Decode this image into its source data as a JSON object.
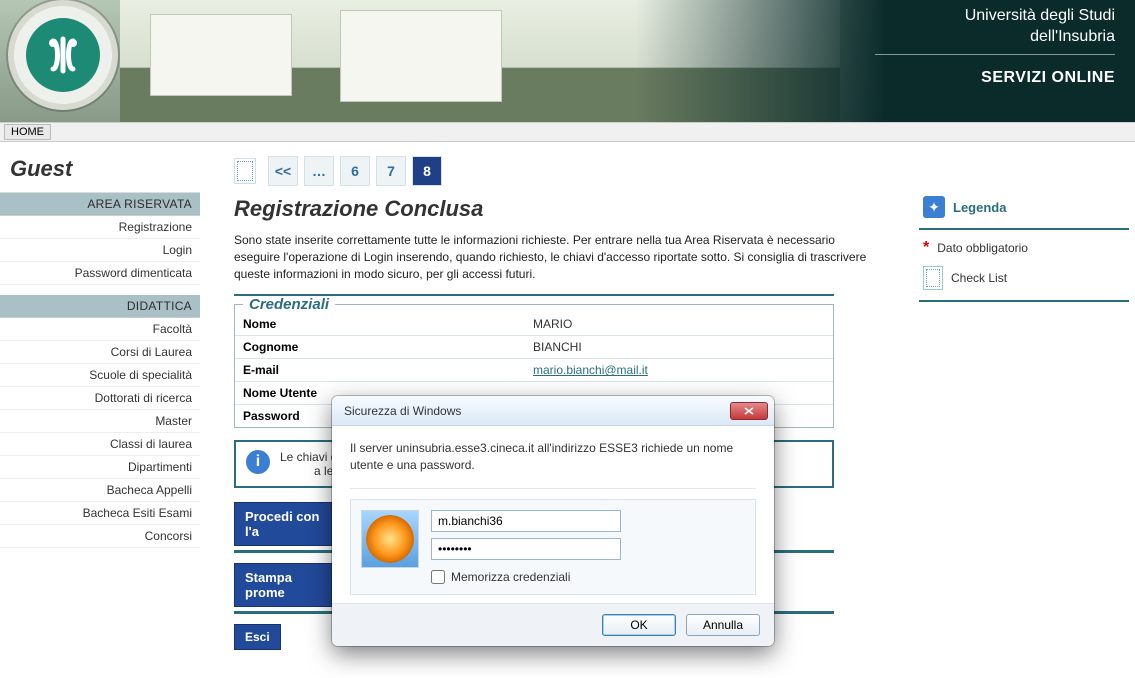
{
  "banner": {
    "university_line1": "Università degli Studi",
    "university_line2": "dell'Insubria",
    "services_label": "SERVIZI ONLINE"
  },
  "topnav": {
    "home": "HOME"
  },
  "sidebar": {
    "guest": "Guest",
    "section_reserved": "AREA RISERVATA",
    "reserved_items": [
      {
        "label": "Registrazione"
      },
      {
        "label": "Login"
      },
      {
        "label": "Password dimenticata"
      }
    ],
    "section_didattica": "DIDATTICA",
    "didattica_items": [
      {
        "label": "Facoltà"
      },
      {
        "label": "Corsi di Laurea"
      },
      {
        "label": "Scuole di specialità"
      },
      {
        "label": "Dottorati di ricerca"
      },
      {
        "label": "Master"
      },
      {
        "label": "Classi di laurea"
      },
      {
        "label": "Dipartimenti"
      },
      {
        "label": "Bacheca Appelli"
      },
      {
        "label": "Bacheca Esiti Esami"
      },
      {
        "label": "Concorsi"
      }
    ]
  },
  "pager": {
    "prev": "<<",
    "dots": "…",
    "p6": "6",
    "p7": "7",
    "p8": "8"
  },
  "main": {
    "title": "Registrazione Conclusa",
    "intro": "Sono state inserite correttamente tutte le informazioni richieste. Per entrare nella tua Area Riservata è necessario eseguire l'operazione di Login inserendo, quando richiesto, le chiavi d'accesso riportate sotto. Si consiglia di trascrivere queste informazioni in modo sicuro, per gli accessi futuri.",
    "cred_legend": "Credenziali",
    "cred_rows": {
      "nome_label": "Nome",
      "nome_value": "MARIO",
      "cognome_label": "Cognome",
      "cognome_value": "BIANCHI",
      "email_label": "E-mail",
      "email_value": "mario.bianchi@mail.it",
      "nomeutente_label": "Nome Utente",
      "nomeutente_value": "",
      "password_label": "Password",
      "password_value": ""
    },
    "info_note_prefix": "Le chiavi d",
    "info_note_suffix": "a lei inserito.",
    "btn_procedi": "Procedi con l'a",
    "btn_stampa": "Stampa prome",
    "btn_esci": "Esci"
  },
  "right": {
    "legenda": "Legenda",
    "dato_obbl": "Dato obbligatorio",
    "checklist": "Check List"
  },
  "dialog": {
    "title": "Sicurezza di Windows",
    "message": "Il server uninsubria.esse3.cineca.it all'indirizzo ESSE3 richiede un nome utente e una password.",
    "username_value": "m.bianchi36",
    "password_value": "••••••••",
    "remember": "Memorizza credenziali",
    "ok": "OK",
    "cancel": "Annulla"
  }
}
